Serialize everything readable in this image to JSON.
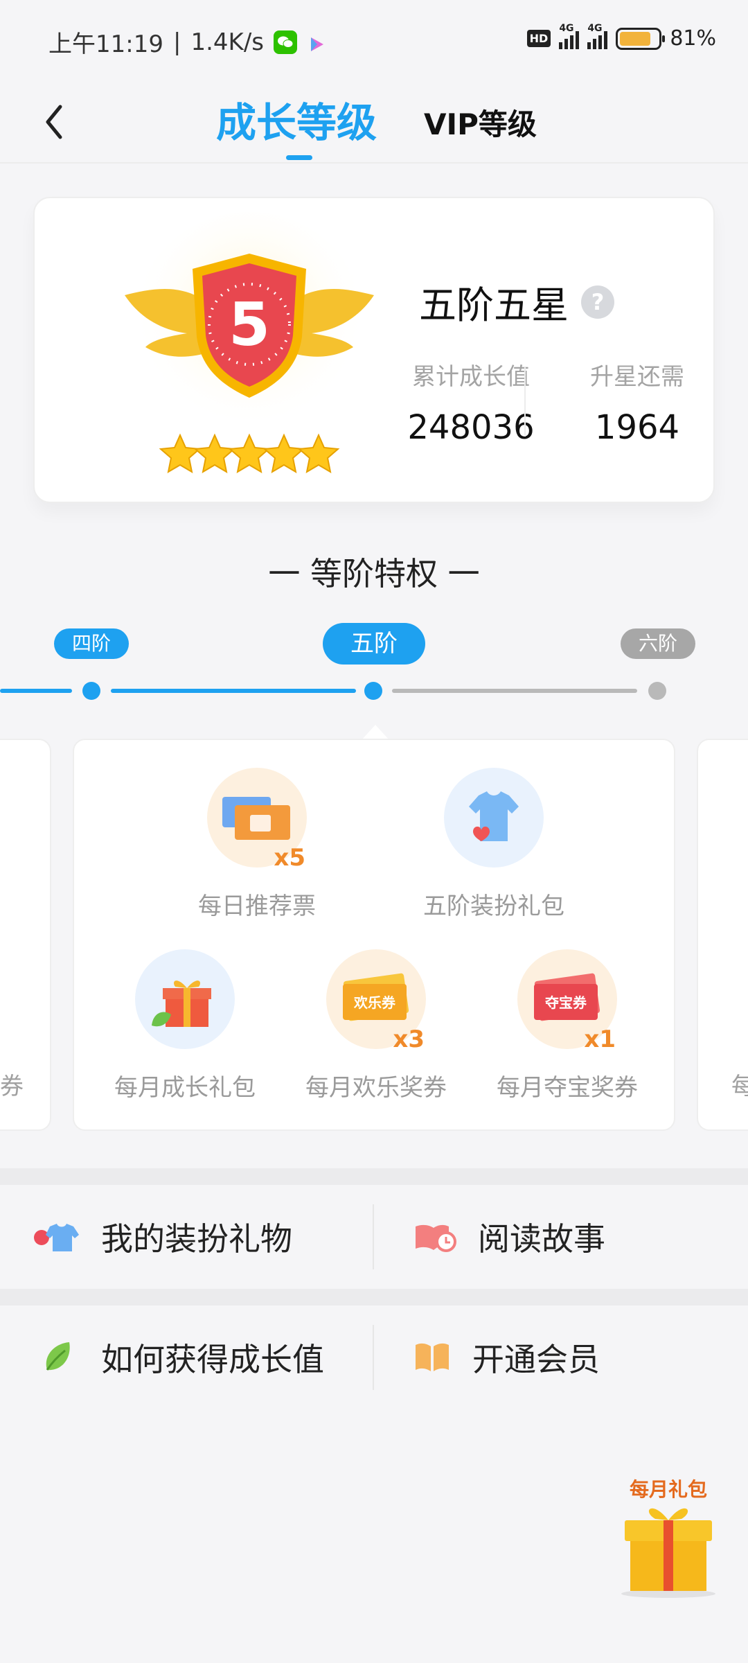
{
  "status_bar": {
    "time": "上午11:19",
    "speed": "1.4K/s",
    "hd": "HD",
    "network1": "4G",
    "network2": "4G",
    "battery_pct": "81%",
    "battery_level": 0.81
  },
  "header": {
    "tab_growth": "成长等级",
    "tab_vip": "VIP等级"
  },
  "level_card": {
    "badge_number": "5",
    "stars": 5,
    "level_name": "五阶五星",
    "help": "?",
    "total_label": "累计成长值",
    "total_value": "248036",
    "need_label": "升星还需",
    "need_value": "1964"
  },
  "privileges": {
    "title": "一 等阶特权 一",
    "tiers": [
      "四阶",
      "五阶",
      "六阶"
    ],
    "items": [
      {
        "label": "每日推荐票",
        "multiplier": "x5"
      },
      {
        "label": "五阶装扮礼包",
        "multiplier": ""
      },
      {
        "label": "每月成长礼包",
        "multiplier": ""
      },
      {
        "label": "每月欢乐奖券",
        "multiplier": "x3",
        "ticket_text": "欢乐券"
      },
      {
        "label": "每月夺宝奖券",
        "multiplier": "x1",
        "ticket_text": "夺宝券"
      }
    ],
    "side_left_text": "券",
    "side_right_text": "每"
  },
  "menu": {
    "dress_gifts": "我的装扮礼物",
    "read_story": "阅读故事",
    "how_growth": "如何获得成长值",
    "open_member": "开通会员"
  },
  "float_gift": {
    "label": "每月礼包"
  },
  "colors": {
    "accent": "#1ea1f0",
    "inactive": "#a7a7a7"
  }
}
